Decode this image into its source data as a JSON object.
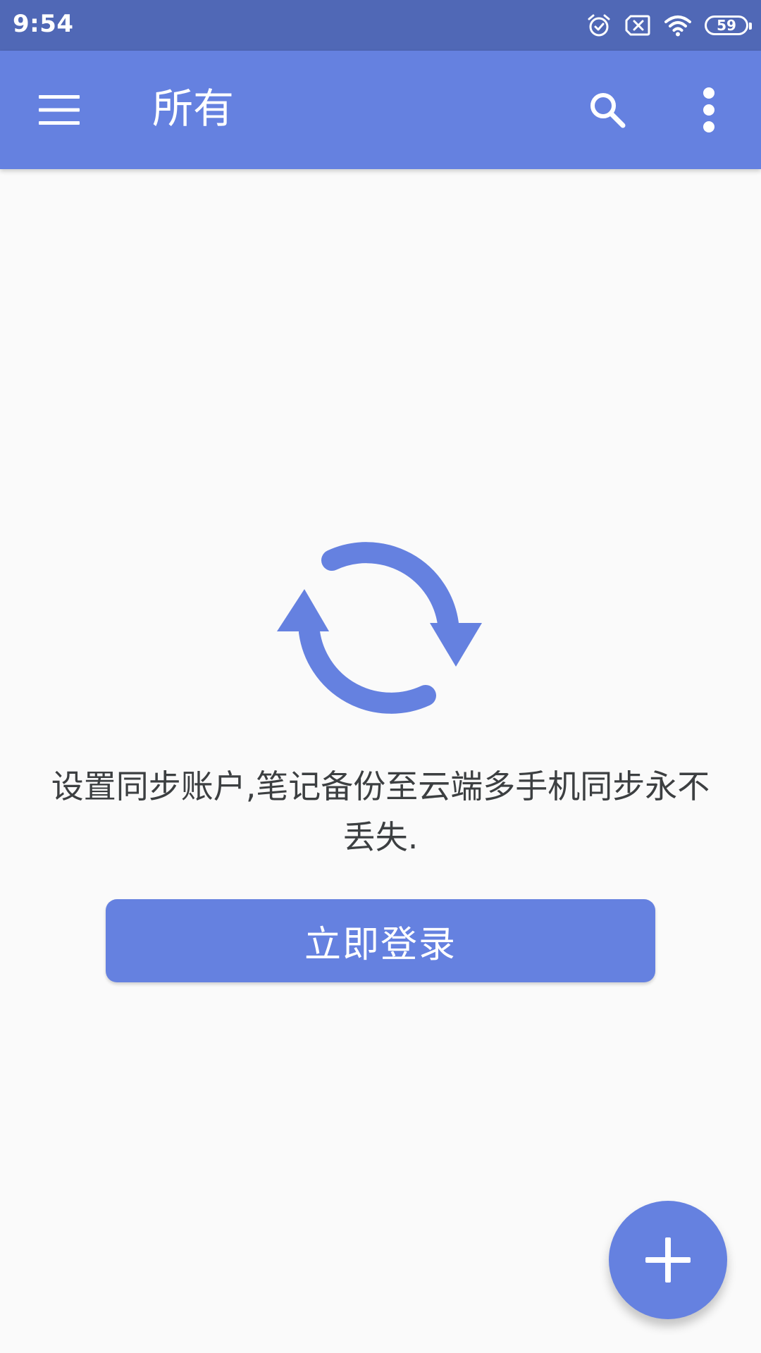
{
  "status_bar": {
    "time": "9:54",
    "battery_level": "59",
    "icons": [
      "alarm-icon",
      "sim-error-icon",
      "wifi-icon",
      "battery-icon"
    ]
  },
  "app_bar": {
    "title": "所有",
    "icons": {
      "menu": "menu-icon",
      "search": "search-icon",
      "more": "more-vertical-icon"
    }
  },
  "empty_state": {
    "icon": "sync-icon",
    "message": "设置同步账户,笔记备份至云端多手机同步永不丢失.",
    "login_label": "立即登录"
  },
  "fab": {
    "icon": "plus-icon"
  },
  "colors": {
    "status_bar": "#5068b6",
    "primary": "#6581e0",
    "background": "#fafafa",
    "text": "#3c3f41"
  }
}
